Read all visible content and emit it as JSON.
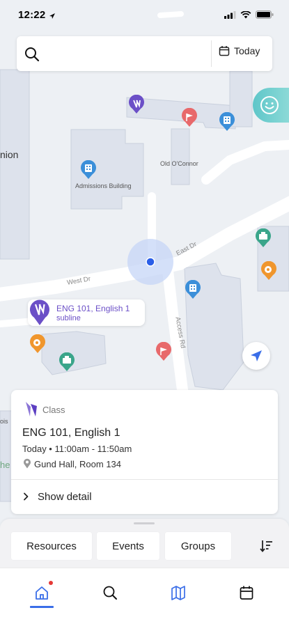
{
  "status_bar": {
    "time": "12:22"
  },
  "search": {
    "date_label": "Today"
  },
  "map": {
    "labels": {
      "union": "nion",
      "admissions": "Admissions Building",
      "oconnor": "Old O'Connor",
      "east_dr": "East Dr",
      "west_dr": "West Dr",
      "access_rd": "Access Rd",
      "edge_bottom_left_1": "ois",
      "edge_bottom_left_2": "he"
    }
  },
  "callout": {
    "title": "ENG 101, English 1",
    "subtitle": "subline"
  },
  "card": {
    "type": "Class",
    "title": "ENG 101, English 1",
    "when": "Today • 11:00am - 11:50am",
    "where": "Gund Hall, Room 134",
    "detail_label": "Show detail"
  },
  "sheet": {
    "chips": [
      "Resources",
      "Events",
      "Groups"
    ]
  },
  "colors": {
    "accent": "#3a6ee8",
    "brand_purple": "#6b4fc7",
    "pin_red": "#e8696b",
    "pin_blue": "#3b8fd9",
    "pin_green": "#3aa58a",
    "pin_orange": "#f0962d"
  }
}
